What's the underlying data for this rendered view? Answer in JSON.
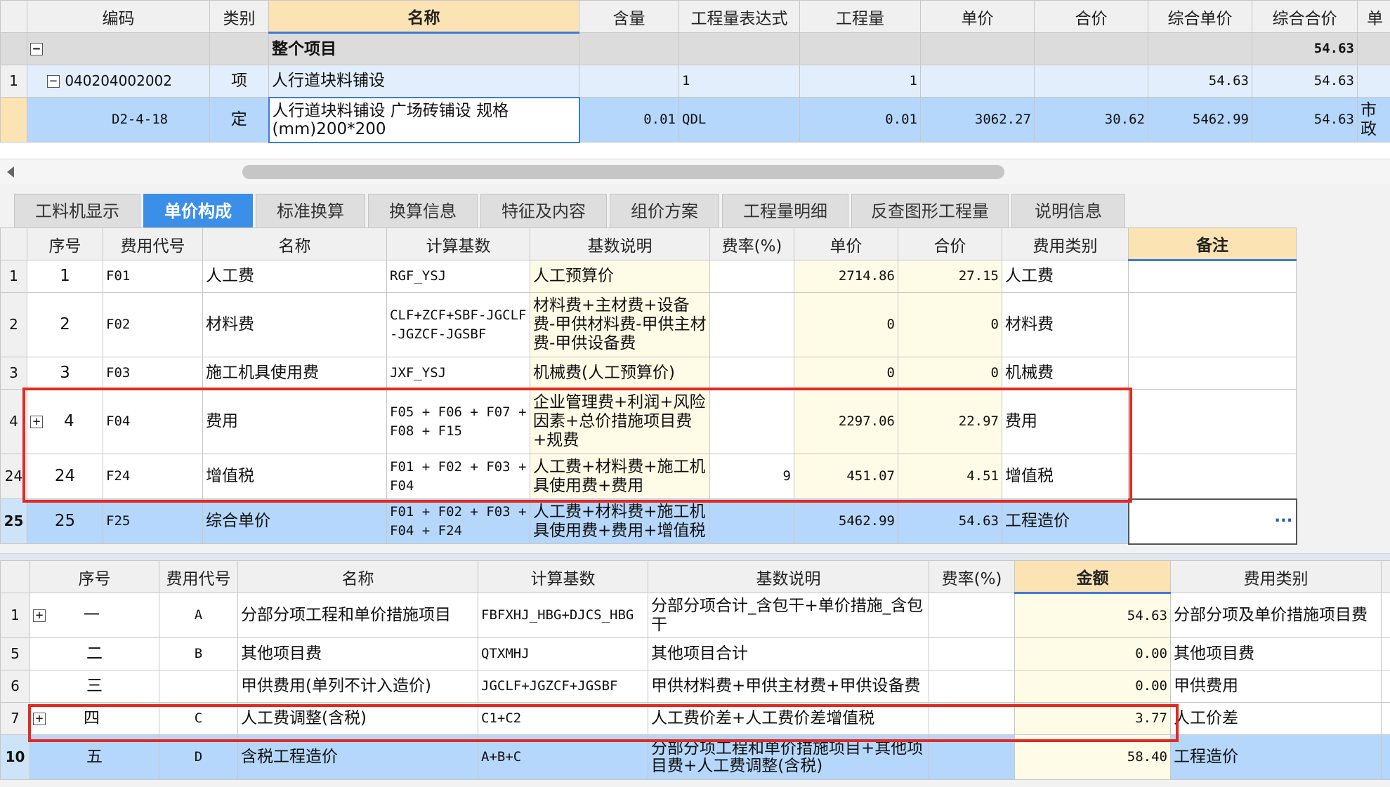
{
  "top_table": {
    "headers": {
      "code": "编码",
      "type": "类别",
      "name": "名称",
      "qty_ratio": "含量",
      "qty_expr": "工程量表达式",
      "qty": "工程量",
      "unit_price": "单价",
      "total_price": "合价",
      "comp_unit_price": "综合单价",
      "comp_total": "综合合价",
      "extra": "单"
    },
    "project_row": {
      "name": "整个项目",
      "comp_total": "54.63"
    },
    "item_row": {
      "index": "1",
      "code": "040204002002",
      "type": "项",
      "name": "人行道块料铺设",
      "qty_expr": "1",
      "qty": "1",
      "comp_unit_price": "54.63",
      "comp_total": "54.63"
    },
    "quota_row": {
      "code": "D2-4-18",
      "type": "定",
      "name": "人行道块料铺设 广场砖铺设 规格(mm)200*200",
      "qty_ratio": "0.01",
      "qty_expr": "QDL",
      "qty": "0.01",
      "unit_price": "3062.27",
      "total_price": "30.62",
      "comp_unit_price": "5462.99",
      "comp_total": "54.63",
      "extra": "市政"
    }
  },
  "tabs": [
    {
      "label": "工料机显示"
    },
    {
      "label": "单价构成"
    },
    {
      "label": "标准换算"
    },
    {
      "label": "换算信息"
    },
    {
      "label": "特征及内容"
    },
    {
      "label": "组价方案"
    },
    {
      "label": "工程量明细"
    },
    {
      "label": "反查图形工程量"
    },
    {
      "label": "说明信息"
    }
  ],
  "active_tab": "单价构成",
  "mid_table": {
    "headers": {
      "seq": "序号",
      "fee_code": "费用代号",
      "name": "名称",
      "base": "计算基数",
      "base_desc": "基数说明",
      "rate": "费率(%)",
      "unit_price": "单价",
      "total": "合价",
      "fee_type": "费用类别",
      "remark": "备注"
    },
    "rows": [
      {
        "rn": "1",
        "seq": "1",
        "code": "F01",
        "name": "人工费",
        "base": "RGF_YSJ",
        "desc": "人工预算价",
        "rate": "",
        "unit_price": "2714.86",
        "total": "27.15",
        "fee_type": "人工费"
      },
      {
        "rn": "2",
        "seq": "2",
        "code": "F02",
        "name": "材料费",
        "base": "CLF+ZCF+SBF-JGCLF-JGZCF-JGSBF",
        "desc": "材料费+主材费+设备费-甲供材料费-甲供主材费-甲供设备费",
        "rate": "",
        "unit_price": "0",
        "total": "0",
        "fee_type": "材料费"
      },
      {
        "rn": "3",
        "seq": "3",
        "code": "F03",
        "name": "施工机具使用费",
        "base": "JXF_YSJ",
        "desc": "机械费(人工预算价)",
        "rate": "",
        "unit_price": "0",
        "total": "0",
        "fee_type": "机械费"
      },
      {
        "rn": "4",
        "seq": "4",
        "code": "F04",
        "name": "费用",
        "base": "F05 + F06 + F07 + F08 + F15",
        "desc": "企业管理费+利润+风险因素+总价措施项目费+规费",
        "rate": "",
        "unit_price": "2297.06",
        "total": "22.97",
        "fee_type": "费用"
      },
      {
        "rn": "24",
        "seq": "24",
        "code": "F24",
        "name": "增值税",
        "base": "F01 + F02 + F03 + F04",
        "desc": "人工费+材料费+施工机具使用费+费用",
        "rate": "9",
        "unit_price": "451.07",
        "total": "4.51",
        "fee_type": "增值税"
      },
      {
        "rn": "25",
        "seq": "25",
        "code": "F25",
        "name": "综合单价",
        "base": "F01 + F02 + F03 + F04 + F24",
        "desc": "人工费+材料费+施工机具使用费+费用+增值税",
        "rate": "",
        "unit_price": "5462.99",
        "total": "54.63",
        "fee_type": "工程造价",
        "remark": "···"
      }
    ]
  },
  "bottom_table": {
    "headers": {
      "seq": "序号",
      "fee_code": "费用代号",
      "name": "名称",
      "base": "计算基数",
      "base_desc": "基数说明",
      "rate": "费率(%)",
      "amount": "金额",
      "fee_type": "费用类别"
    },
    "rows": [
      {
        "rn": "1",
        "seq": "一",
        "code": "A",
        "name": "分部分项工程和单价措施项目",
        "base": "FBFXHJ_HBG+DJCS_HBG",
        "desc": "分部分项合计_含包干+单价措施_含包干",
        "amount": "54.63",
        "fee_type": "分部分项及单价措施项目费"
      },
      {
        "rn": "5",
        "seq": "二",
        "code": "B",
        "name": "其他项目费",
        "base": "QTXMHJ",
        "desc": "其他项目合计",
        "amount": "0.00",
        "fee_type": "其他项目费"
      },
      {
        "rn": "6",
        "seq": "三",
        "code": "",
        "name": "甲供费用(单列不计入造价)",
        "base": "JGCLF+JGZCF+JGSBF",
        "desc": "甲供材料费+甲供主材费+甲供设备费",
        "amount": "0.00",
        "fee_type": "甲供费用"
      },
      {
        "rn": "7",
        "seq": "四",
        "code": "C",
        "name": "人工费调整(含税)",
        "base": "C1+C2",
        "desc": "人工费价差+人工费价差增值税",
        "amount": "3.77",
        "fee_type": "人工价差"
      },
      {
        "rn": "10",
        "seq": "五",
        "code": "D",
        "name": "含税工程造价",
        "base": "A+B+C",
        "desc": "分部分项工程和单价措施项目+其他项目费+人工费调整(含税)",
        "amount": "58.40",
        "fee_type": "工程造价"
      }
    ]
  },
  "icons": {
    "expand": "+",
    "collapse": "−"
  },
  "colors": {
    "highlight_box": "#e32a22",
    "selected_row": "#b5d7fb",
    "active_tab": "#3b8fe8",
    "header_highlight": "#fbe3b3"
  }
}
